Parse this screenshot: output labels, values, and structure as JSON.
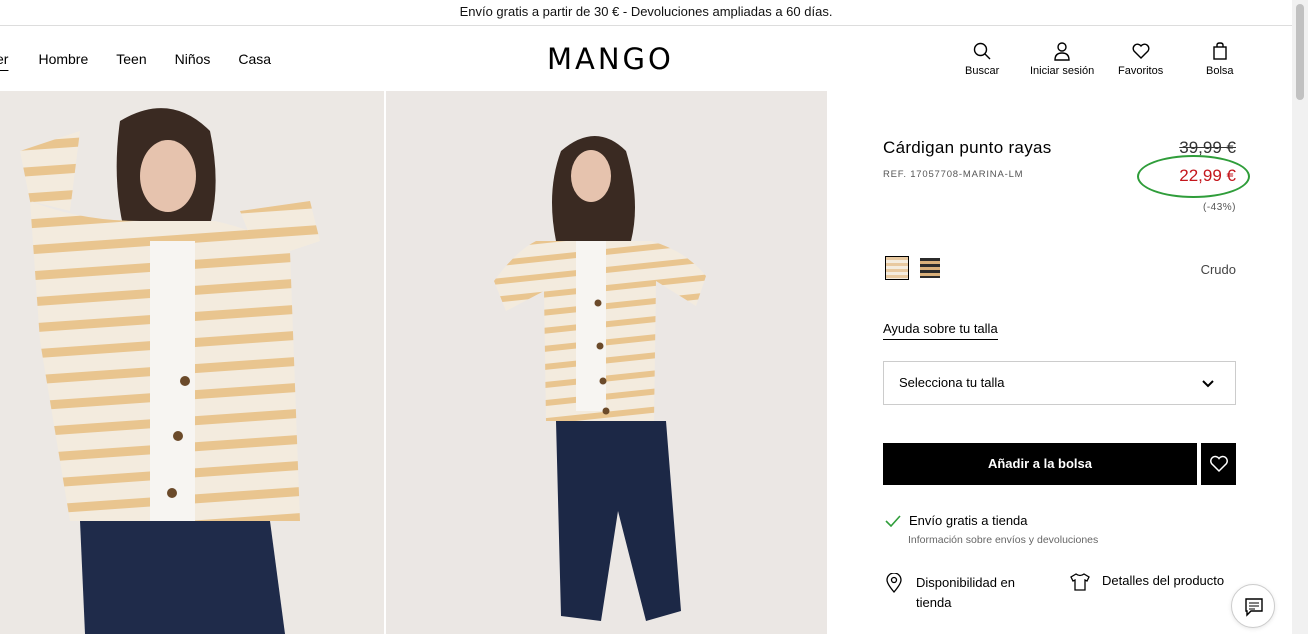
{
  "promo": "Envío gratis a partir de 30 € - Devoluciones ampliadas a 60 días.",
  "nav": {
    "partial": "er",
    "items": [
      "Hombre",
      "Teen",
      "Niños",
      "Casa"
    ]
  },
  "logo": "MANGO",
  "header_actions": {
    "search": "Buscar",
    "login": "Iniciar sesión",
    "favorites": "Favoritos",
    "bag": "Bolsa"
  },
  "product": {
    "title": "Cárdigan punto rayas",
    "ref": "REF. 17057708-MARINA-LM",
    "old_price": "39,99 €",
    "price": "22,99 €",
    "discount": "(-43%)",
    "color_name": "Crudo",
    "size_help": "Ayuda sobre tu talla",
    "size_select": "Selecciona tu talla",
    "add_to_bag": "Añadir a la bolsa",
    "shipping": "Envío gratis a tienda",
    "shipping_info": "Información sobre envíos y devoluciones",
    "availability": "Disponibilidad en tienda",
    "details": "Detalles del producto"
  },
  "colors": {
    "price_red": "#c4161c",
    "highlight_circle": "#2f9d3a"
  }
}
